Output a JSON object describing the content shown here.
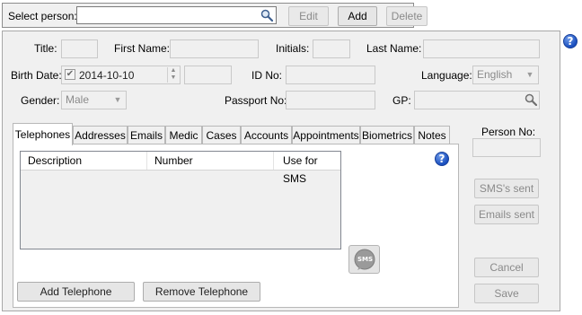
{
  "topbar": {
    "select_person_label": "Select person:",
    "search_value": "",
    "edit_label": "Edit",
    "add_label": "Add",
    "delete_label": "Delete"
  },
  "form": {
    "title_label": "Title:",
    "title_value": "",
    "first_name_label": "First Name:",
    "first_name_value": "",
    "initials_label": "Initials:",
    "initials_value": "",
    "last_name_label": "Last Name:",
    "last_name_value": "",
    "birth_date_label": "Birth Date:",
    "birth_date_value": "2014-10-10",
    "birth_date_checked": true,
    "age_value": "",
    "id_no_label": "ID No:",
    "id_no_value": "",
    "language_label": "Language:",
    "language_value": "English",
    "gender_label": "Gender:",
    "gender_value": "Male",
    "passport_label": "Passport No:",
    "passport_value": "",
    "gp_label": "GP:",
    "gp_value": ""
  },
  "tabs": [
    {
      "label": "Telephones",
      "active": true
    },
    {
      "label": "Addresses"
    },
    {
      "label": "Emails"
    },
    {
      "label": "Medic"
    },
    {
      "label": "Cases"
    },
    {
      "label": "Accounts"
    },
    {
      "label": "Appointments"
    },
    {
      "label": "Biometrics"
    },
    {
      "label": "Notes"
    }
  ],
  "phones_table": {
    "columns": [
      "Description",
      "Number",
      "Use for SMS"
    ],
    "rows": []
  },
  "tab_buttons": {
    "add_telephone": "Add Telephone",
    "remove_telephone": "Remove Telephone",
    "sms_icon_text": "SMS"
  },
  "right_panel": {
    "person_no_label": "Person No:",
    "person_no_value": "",
    "sms_sent_label": "SMS's sent",
    "emails_sent_label": "Emails sent",
    "cancel_label": "Cancel",
    "save_label": "Save"
  },
  "help_icon_text": "?",
  "colors": {
    "window_bg": "#f0f0f0",
    "help_icon": "#1a4fbf",
    "disabled_text": "#8a8a8a"
  }
}
